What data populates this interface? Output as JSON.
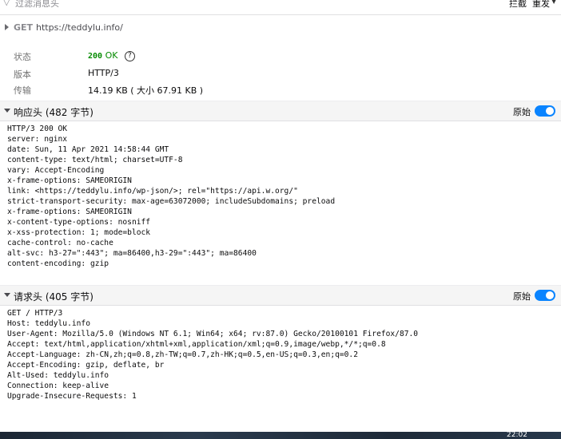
{
  "filter": {
    "placeholder": "过滤消息头",
    "block_label": "拦截",
    "resend_label": "重发"
  },
  "request": {
    "method": "GET",
    "url": "https://teddylu.info/"
  },
  "summary": {
    "status_label": "状态",
    "status_code": "200",
    "status_text": "OK",
    "version_label": "版本",
    "version_value": "HTTP/3",
    "transfer_label": "传输",
    "transfer_value": "14.19 KB ( 大小 67.91 KB )"
  },
  "response_headers": {
    "title": "响应头 (482 字节)",
    "raw_label": "原始",
    "raw_on": true,
    "lines": [
      "HTTP/3 200 OK",
      "server: nginx",
      "date: Sun, 11 Apr 2021 14:58:44 GMT",
      "content-type: text/html; charset=UTF-8",
      "vary: Accept-Encoding",
      "x-frame-options: SAMEORIGIN",
      "link: <https://teddylu.info/wp-json/>; rel=\"https://api.w.org/\"",
      "strict-transport-security: max-age=63072000; includeSubdomains; preload",
      "x-frame-options: SAMEORIGIN",
      "x-content-type-options: nosniff",
      "x-xss-protection: 1; mode=block",
      "cache-control: no-cache",
      "alt-svc: h3-27=\":443\"; ma=86400,h3-29=\":443\"; ma=86400",
      "content-encoding: gzip"
    ]
  },
  "request_headers": {
    "title": "请求头 (405 字节)",
    "raw_label": "原始",
    "raw_on": true,
    "lines": [
      "GET / HTTP/3",
      "Host: teddylu.info",
      "User-Agent: Mozilla/5.0 (Windows NT 6.1; Win64; x64; rv:87.0) Gecko/20100101 Firefox/87.0",
      "Accept: text/html,application/xhtml+xml,application/xml;q=0.9,image/webp,*/*;q=0.8",
      "Accept-Language: zh-CN,zh;q=0.8,zh-TW;q=0.7,zh-HK;q=0.5,en-US;q=0.3,en;q=0.2",
      "Accept-Encoding: gzip, deflate, br",
      "Alt-Used: teddylu.info",
      "Connection: keep-alive",
      "Upgrade-Insecure-Requests: 1"
    ]
  },
  "taskbar": {
    "clock": "22:02"
  }
}
